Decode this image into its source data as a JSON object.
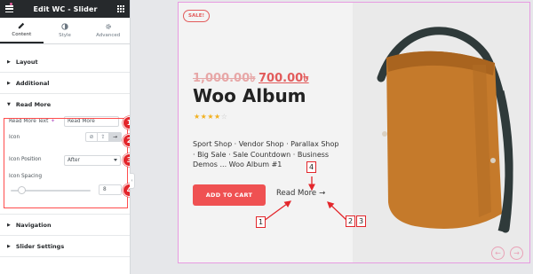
{
  "editor": {
    "title": "Edit WC - Slider",
    "tabs": [
      {
        "label": "Content",
        "icon": "pencil-icon",
        "active": true
      },
      {
        "label": "Style",
        "icon": "contrast-icon",
        "active": false
      },
      {
        "label": "Advanced",
        "icon": "gear-icon",
        "active": false
      }
    ],
    "sections": {
      "layout": "Layout",
      "additional": "Additional",
      "read_more": "Read More",
      "navigation": "Navigation",
      "slider_settings": "Slider Settings"
    },
    "controls": {
      "read_more_text_label": "Read More Text",
      "read_more_text_value": "Read More",
      "icon_label": "Icon",
      "icon_choices": [
        "none-icon",
        "upload-icon",
        "arrow-right-icon"
      ],
      "icon_position_label": "Icon Position",
      "icon_position_value": "After",
      "icon_spacing_label": "Icon Spacing",
      "icon_spacing_value": "8"
    },
    "callouts": [
      "1",
      "2",
      "3",
      "4"
    ]
  },
  "preview": {
    "sale_badge": "SALE!",
    "price_old": "1,000.00৳",
    "price_new": "700.00৳",
    "product_title": "Woo Album",
    "rating": 4,
    "rating_max": 5,
    "description": "Sport Shop · Vendor Shop · Parallax Shop · Big Sale · Sale Countdown · Business Demos ... Woo Album #1",
    "add_to_cart": "ADD TO CART",
    "read_more": "Read More",
    "read_more_icon": "→",
    "nav_prev": "←",
    "nav_next": "→",
    "annotations": [
      "1",
      "2",
      "3",
      "4"
    ]
  },
  "colors": {
    "accent_red": "#ef5152",
    "callout_red": "#e3262b",
    "price_red": "#e25b5b",
    "star": "#f2b01e",
    "editor_dark": "#26292c",
    "bag_tan": "#c57a2b",
    "strap_dark": "#2f3a3a"
  }
}
